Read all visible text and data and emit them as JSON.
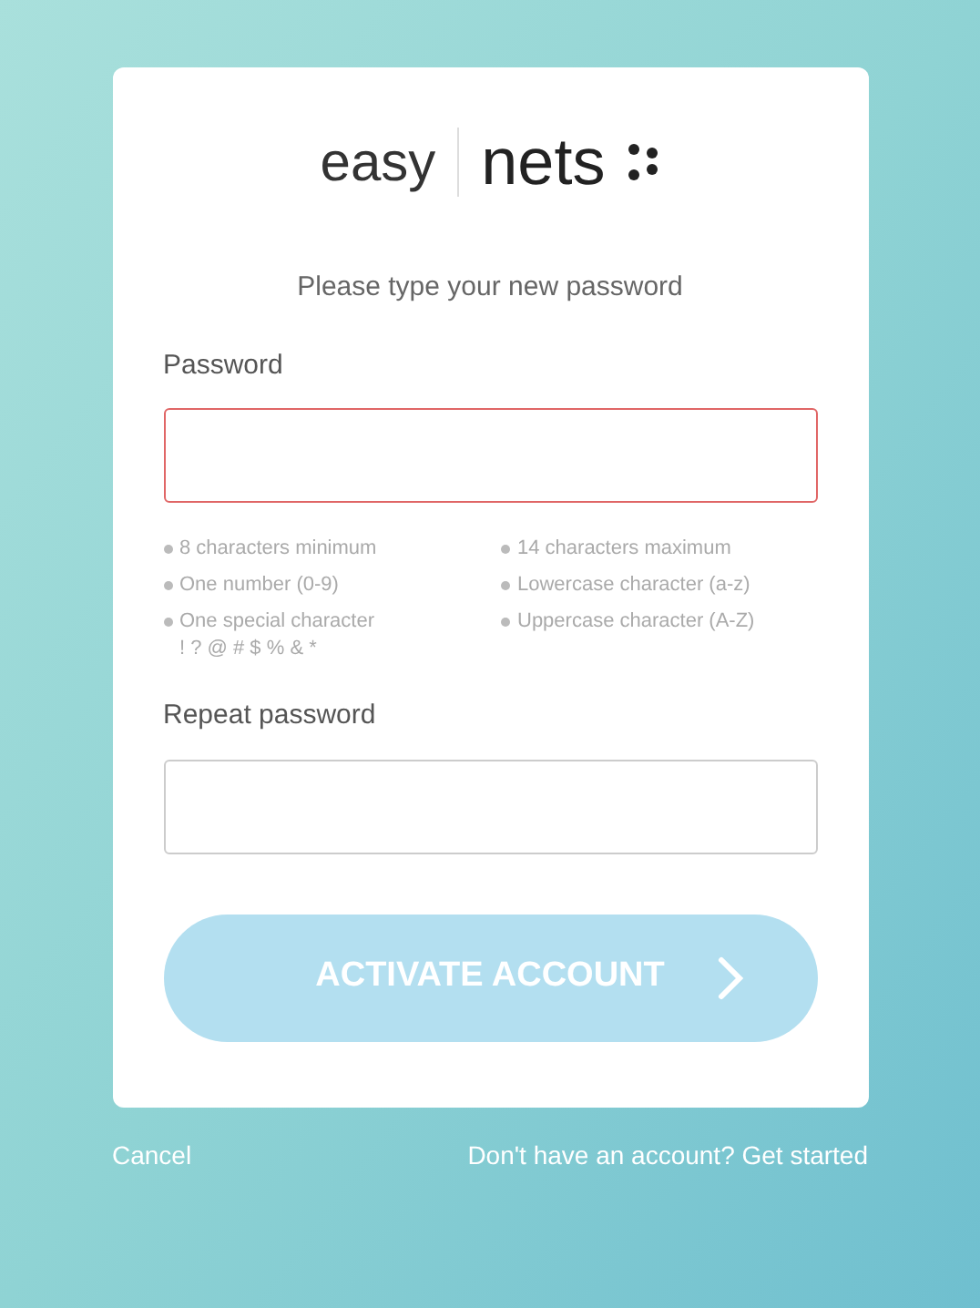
{
  "logo": {
    "left": "easy",
    "right": "nets"
  },
  "heading": "Please type your new password",
  "fields": [
    {
      "label": "Password",
      "error": true
    },
    {
      "label": "Repeat password",
      "error": false
    }
  ],
  "requirements": [
    "8 characters minimum",
    "14 characters maximum",
    "One number (0-9)",
    "Lowercase character (a-z)",
    "One special character\n! ? @ # $ % & *",
    "Uppercase character (A-Z)"
  ],
  "submit": {
    "label": "ACTIVATE ACCOUNT",
    "disabled": true
  },
  "footer": {
    "cancel": "Cancel",
    "signup": "Don't have an account? Get started"
  }
}
